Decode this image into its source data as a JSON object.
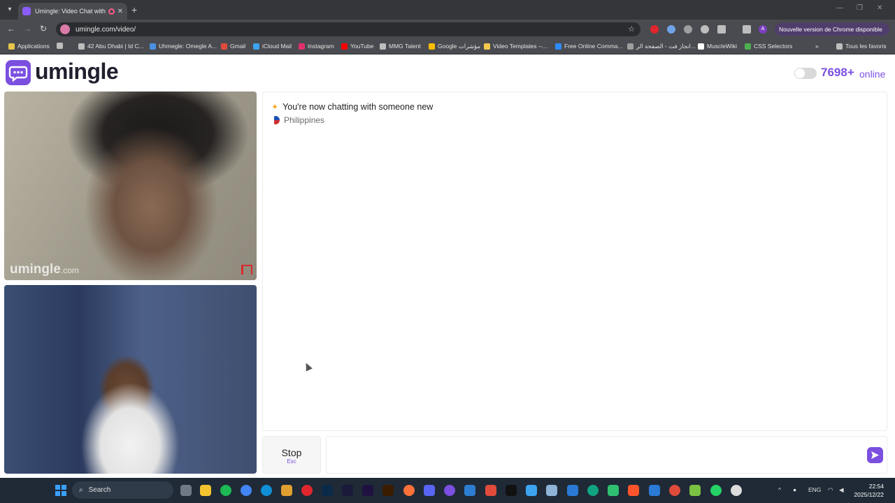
{
  "browser": {
    "tab_title": "Umingle: Video Chat with S",
    "url": "umingle.com/video/",
    "update_notice": "Nouvelle version de Chrome disponible",
    "profile_initial": "A",
    "bookmarks": [
      {
        "label": "Applications",
        "color": "#e8c64a"
      },
      {
        "label": "42 Abu Dhabi | Id C...",
        "color": "#bdbdbd"
      },
      {
        "label": "Uhmegle: Omegle A...",
        "color": "#4a90e2"
      },
      {
        "label": "Gmail",
        "color": "#e04b3c"
      },
      {
        "label": "iCloud Mail",
        "color": "#3ba3f0"
      },
      {
        "label": "Instagram",
        "color": "#e1306c"
      },
      {
        "label": "YouTube",
        "color": "#ff0000"
      },
      {
        "label": "MMG Talent",
        "color": "#bdbdbd"
      },
      {
        "label": "Google مؤشرات",
        "color": "#fbbc05"
      },
      {
        "label": "Video Templates --...",
        "color": "#f2c94c"
      },
      {
        "label": "Free Online Comma...",
        "color": "#2d8cff"
      },
      {
        "label": "انجاز فت - الصفحة الر...",
        "color": "#9e9e9e"
      },
      {
        "label": "MuscleWiki",
        "color": "#ffffff"
      },
      {
        "label": "CSS Selectors",
        "color": "#4caf50"
      }
    ],
    "all_bookmarks": "Tous les favoris"
  },
  "header": {
    "logo_text": "umingle",
    "online_count": "7698+",
    "online_label": "online"
  },
  "video": {
    "watermark_brand": "umingle",
    "watermark_suffix": ".com"
  },
  "chat": {
    "status_message": "You're now chatting with someone new",
    "stranger_country": "Philippines"
  },
  "controls": {
    "stop_label": "Stop",
    "stop_shortcut": "Esc",
    "input_placeholder": ""
  },
  "taskbar": {
    "search_label": "Search",
    "language": "ENG",
    "time": "22:54",
    "date": "2025/12/22"
  },
  "colors": {
    "brand": "#7b4fe0"
  }
}
